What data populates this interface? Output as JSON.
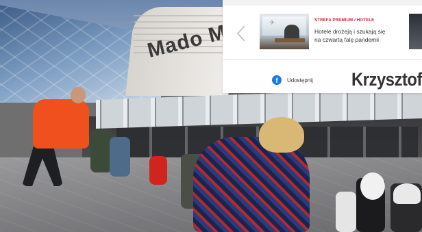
{
  "background_photo": {
    "sign_text": "Mado Ma"
  },
  "card": {
    "prev_icon": "chevron-left-icon",
    "article": {
      "category": "STREFA PREMIUM / HOTELE",
      "headline": "Hotele drożeją i szukają się na czwartą falę pandemii"
    },
    "share": {
      "icon": "facebook-icon",
      "label": "Udostępnij"
    },
    "author_name": "Krzysztof"
  },
  "colors": {
    "category_red": "#d2242b",
    "facebook_blue": "#1877f2",
    "jacket_orange": "#f0501e"
  }
}
